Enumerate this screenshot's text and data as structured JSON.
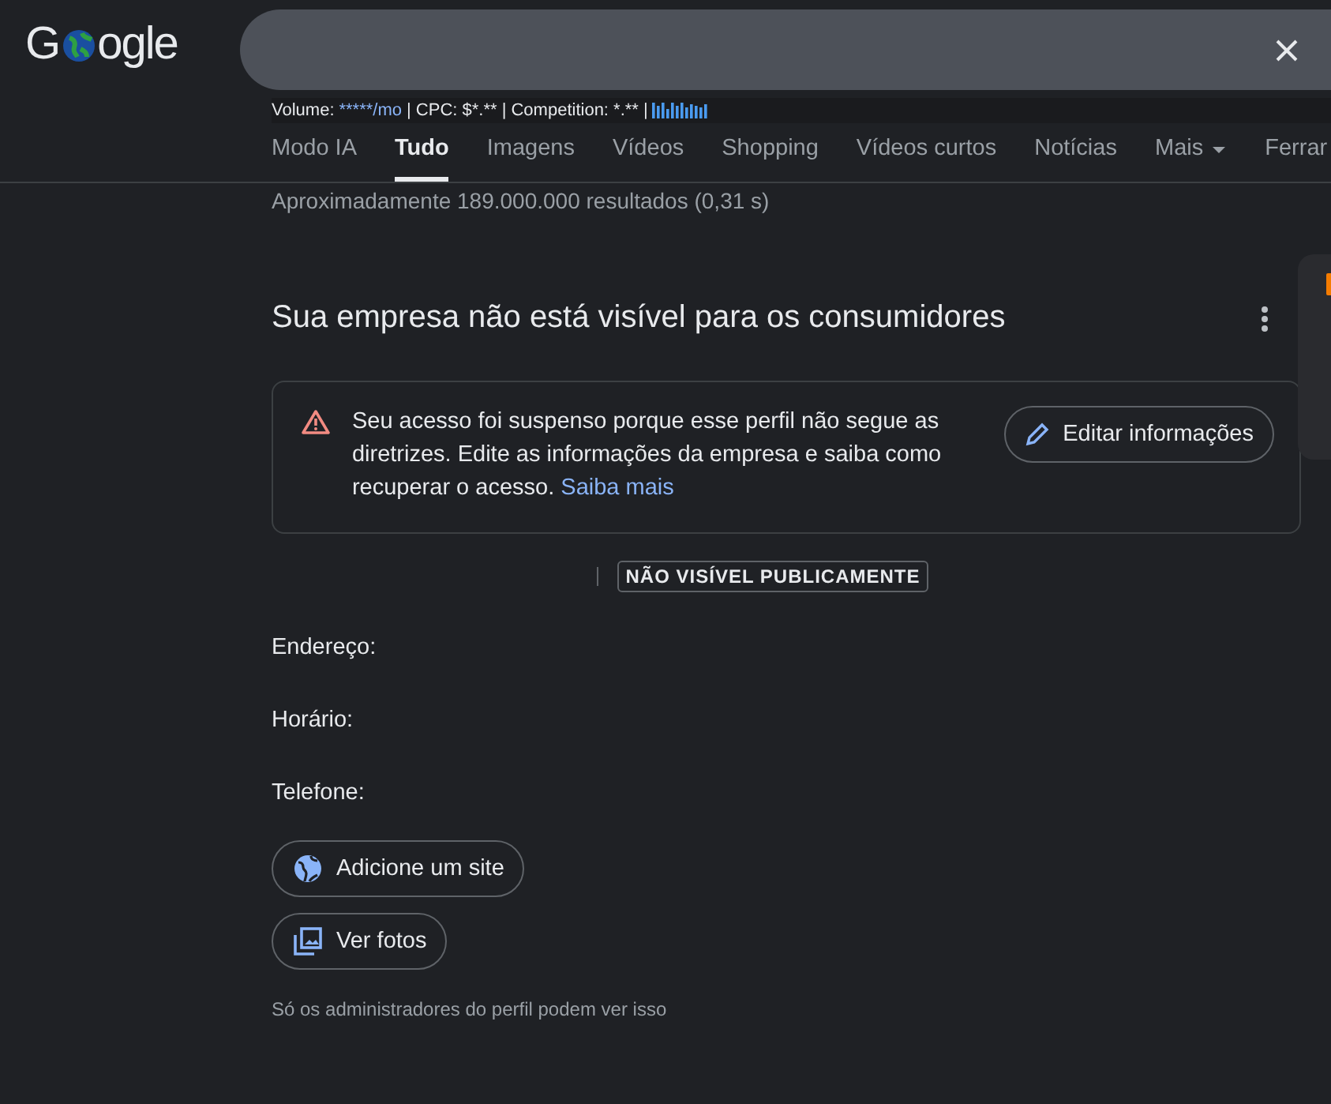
{
  "logo": {
    "before": "G",
    "after": "ogle"
  },
  "seo_bar": {
    "volume_label": "Volume:",
    "volume_value": "*****/mo",
    "rest": "| CPC: $*.** | Competition: *.** |"
  },
  "tabs": [
    {
      "label": "Modo IA",
      "selected": false
    },
    {
      "label": "Tudo",
      "selected": true
    },
    {
      "label": "Imagens",
      "selected": false
    },
    {
      "label": "Vídeos",
      "selected": false
    },
    {
      "label": "Shopping",
      "selected": false
    },
    {
      "label": "Vídeos curtos",
      "selected": false
    },
    {
      "label": "Notícias",
      "selected": false
    },
    {
      "label": "Mais",
      "selected": false,
      "dropdown": true
    },
    {
      "label": "Ferrar",
      "selected": false
    }
  ],
  "result_stats": "Aproximadamente 189.000.000 resultados (0,31 s)",
  "business": {
    "title": "Sua empresa não está visível para os consumidores",
    "alert": {
      "text": "Seu acesso foi suspenso porque esse perfil não segue as diretrizes. Edite as informações da empresa e saiba como recuperar o acesso.",
      "link": "Saiba mais",
      "button": "Editar informações"
    },
    "badge": "NÃO VISÍVEL PUBLICAMENTE",
    "fields": [
      "Endereço:",
      "Horário:",
      "Telefone:"
    ],
    "actions": [
      {
        "kind": "globe",
        "label": "Adicione um site"
      },
      {
        "kind": "photos",
        "label": "Ver fotos"
      }
    ],
    "note": "Só os administradores do perfil podem ver isso"
  }
}
